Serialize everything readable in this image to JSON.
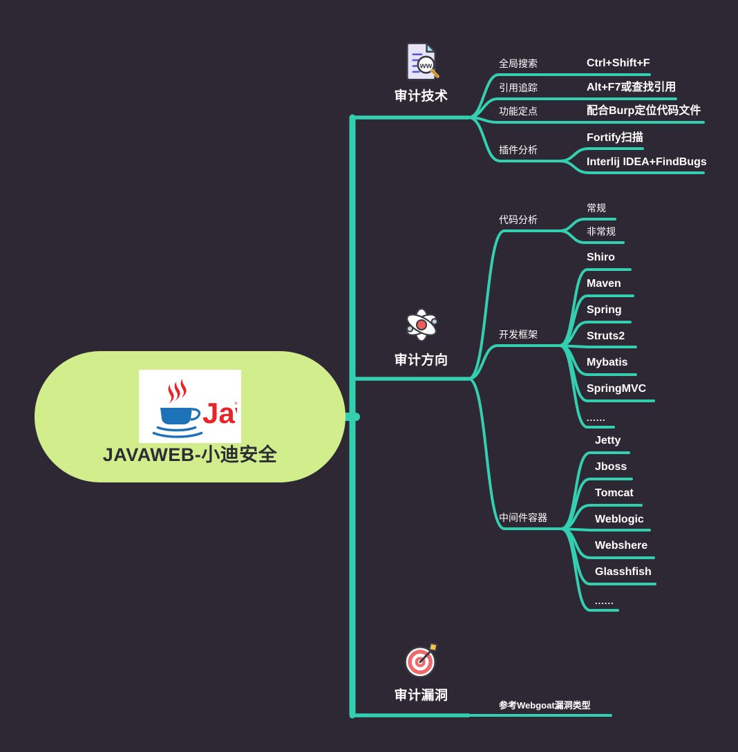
{
  "theme": {
    "background": "#2e2834",
    "branch_color": "#33cfb0",
    "root_fill": "#d2ee8c",
    "root_text": "#2c2c34",
    "node_text": "#ffffff"
  },
  "root": {
    "title": "JAVAWEB-小迪安全",
    "logo_alt": "Java",
    "logo_wordmark": "Java"
  },
  "branches": [
    {
      "id": "audit-tech",
      "label": "审计技术",
      "icon": "document-search-icon",
      "children": [
        {
          "label": "全局搜索",
          "children": [
            {
              "label": "Ctrl+Shift+F"
            }
          ]
        },
        {
          "label": "引用追踪",
          "children": [
            {
              "label": "Alt+F7或查找引用"
            }
          ]
        },
        {
          "label": "功能定点",
          "children": [
            {
              "label": "配合Burp定位代码文件"
            }
          ]
        },
        {
          "label": "插件分析",
          "children": [
            {
              "label": "Fortify扫描"
            },
            {
              "label": "Interlij IDEA+FindBugs"
            }
          ]
        }
      ]
    },
    {
      "id": "audit-direction",
      "label": "审计方向",
      "icon": "atom-icon",
      "children": [
        {
          "label": "代码分析",
          "children": [
            {
              "label": "常规"
            },
            {
              "label": "非常规"
            }
          ]
        },
        {
          "label": "开发框架",
          "children": [
            {
              "label": "Shiro"
            },
            {
              "label": "Maven"
            },
            {
              "label": "Spring"
            },
            {
              "label": "Struts2"
            },
            {
              "label": "Mybatis"
            },
            {
              "label": "SpringMVC"
            },
            {
              "label": "......"
            }
          ]
        },
        {
          "label": "中间件容器",
          "children": [
            {
              "label": "Jetty"
            },
            {
              "label": "Jboss"
            },
            {
              "label": "Tomcat"
            },
            {
              "label": "Weblogic"
            },
            {
              "label": "Webshere"
            },
            {
              "label": "Glasshfish"
            },
            {
              "label": "......"
            }
          ]
        }
      ]
    },
    {
      "id": "audit-vuln",
      "label": "审计漏洞",
      "icon": "target-dart-icon",
      "children": [
        {
          "label": "参考Webgoat漏洞类型",
          "children": []
        }
      ]
    }
  ],
  "labels": {
    "b0": "审计技术",
    "b1": "审计方向",
    "b2": "审计漏洞",
    "n_quanju": "全局搜索",
    "n_quanju_v": "Ctrl+Shift+F",
    "n_yinyong": "引用追踪",
    "n_yinyong_v": "Alt+F7或查找引用",
    "n_gongneng": "功能定点",
    "n_gongneng_v": "配合Burp定位代码文件",
    "n_chajian": "插件分析",
    "n_fortify": "Fortify扫描",
    "n_findbugs": "Interlij IDEA+FindBugs",
    "n_daima": "代码分析",
    "n_changgui": "常规",
    "n_feichanggui": "非常规",
    "n_kuangjia": "开发框架",
    "n_shiro": "Shiro",
    "n_maven": "Maven",
    "n_spring": "Spring",
    "n_struts2": "Struts2",
    "n_mybatis": "Mybatis",
    "n_springmvc": "SpringMVC",
    "n_dots1": "......",
    "n_zhongjianjian": "中间件容器",
    "n_jetty": "Jetty",
    "n_jboss": "Jboss",
    "n_tomcat": "Tomcat",
    "n_weblogic": "Weblogic",
    "n_webshere": "Webshere",
    "n_glasshfish": "Glasshfish",
    "n_dots2": "......",
    "n_webgoat": "参考Webgoat漏洞类型",
    "root_title": "JAVAWEB-小迪安全"
  }
}
